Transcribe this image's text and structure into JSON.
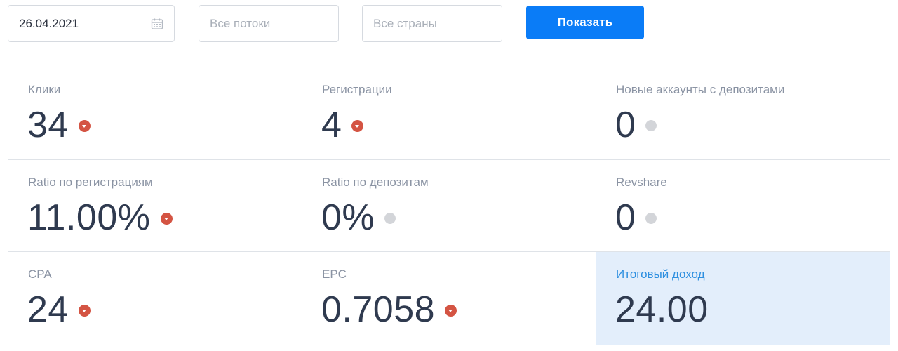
{
  "filters": {
    "date_value": "26.04.2021",
    "date_icon": "calendar-icon",
    "streams_placeholder": "Все потоки",
    "countries_placeholder": "Все страны",
    "show_label": "Показать"
  },
  "colors": {
    "accent": "#0a7cf7",
    "down": "#d45443",
    "neutral": "#d3d5d9",
    "highlight_bg": "#e3eefb",
    "highlight_label": "#2d8fe0"
  },
  "stats": [
    {
      "label": "Клики",
      "value": "34",
      "trend": "down"
    },
    {
      "label": "Регистрации",
      "value": "4",
      "trend": "down"
    },
    {
      "label": "Новые аккаунты с депозитами",
      "value": "0",
      "trend": "neutral"
    },
    {
      "label": "Ratio по регистрациям",
      "value": "11.00%",
      "trend": "down"
    },
    {
      "label": "Ratio по депозитам",
      "value": "0%",
      "trend": "neutral"
    },
    {
      "label": "Revshare",
      "value": "0",
      "trend": "neutral"
    },
    {
      "label": "CPA",
      "value": "24",
      "trend": "down"
    },
    {
      "label": "EPC",
      "value": "0.7058",
      "trend": "down"
    },
    {
      "label": "Итоговый доход",
      "value": "24.00",
      "trend": "none"
    }
  ]
}
